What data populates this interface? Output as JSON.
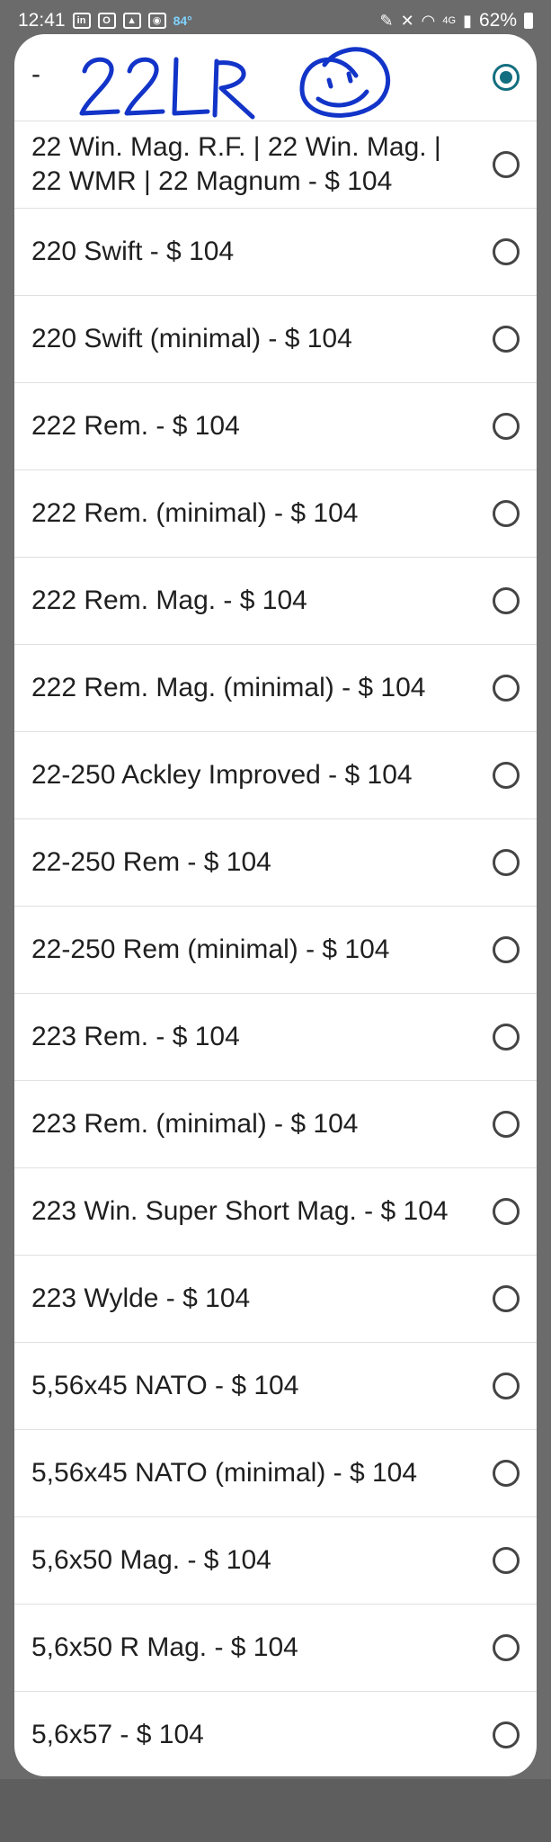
{
  "status_bar": {
    "time": "12:41",
    "temperature": "84°",
    "battery": "62%",
    "left_icons": [
      "linkedin-icon",
      "outlook-icon",
      "gallery-icon",
      "app-icon"
    ],
    "right_icons": [
      "pen-icon",
      "mute-icon",
      "wifi-icon",
      "lte-icon",
      "signal-icon",
      "battery-icon"
    ]
  },
  "dialog": {
    "selected_option": {
      "prefix": "-",
      "handwritten_text": "22 LR",
      "smiley": "smiley-drawing",
      "checked": true
    },
    "options": [
      {
        "label": "22 Win. Mag. R.F. | 22 Win. Mag. | 22 WMR | 22 Magnum - $ 104"
      },
      {
        "label": "220 Swift - $ 104"
      },
      {
        "label": "220 Swift (minimal) - $ 104"
      },
      {
        "label": "222 Rem. - $ 104"
      },
      {
        "label": "222 Rem. (minimal) - $ 104"
      },
      {
        "label": "222 Rem. Mag. - $ 104"
      },
      {
        "label": "222 Rem. Mag. (minimal) - $ 104"
      },
      {
        "label": "22-250 Ackley Improved - $ 104"
      },
      {
        "label": "22-250 Rem - $ 104"
      },
      {
        "label": "22-250 Rem (minimal) - $ 104"
      },
      {
        "label": "223 Rem. - $ 104"
      },
      {
        "label": "223 Rem. (minimal) - $ 104"
      },
      {
        "label": "223 Win. Super Short Mag. - $ 104"
      },
      {
        "label": "223 Wylde - $ 104"
      },
      {
        "label": "5,56x45 NATO - $ 104"
      },
      {
        "label": "5,56x45 NATO (minimal) - $ 104"
      },
      {
        "label": "5,6x50 Mag. - $ 104"
      },
      {
        "label": "5,6x50 R Mag. - $ 104"
      },
      {
        "label": "5,6x57 - $ 104"
      }
    ]
  }
}
